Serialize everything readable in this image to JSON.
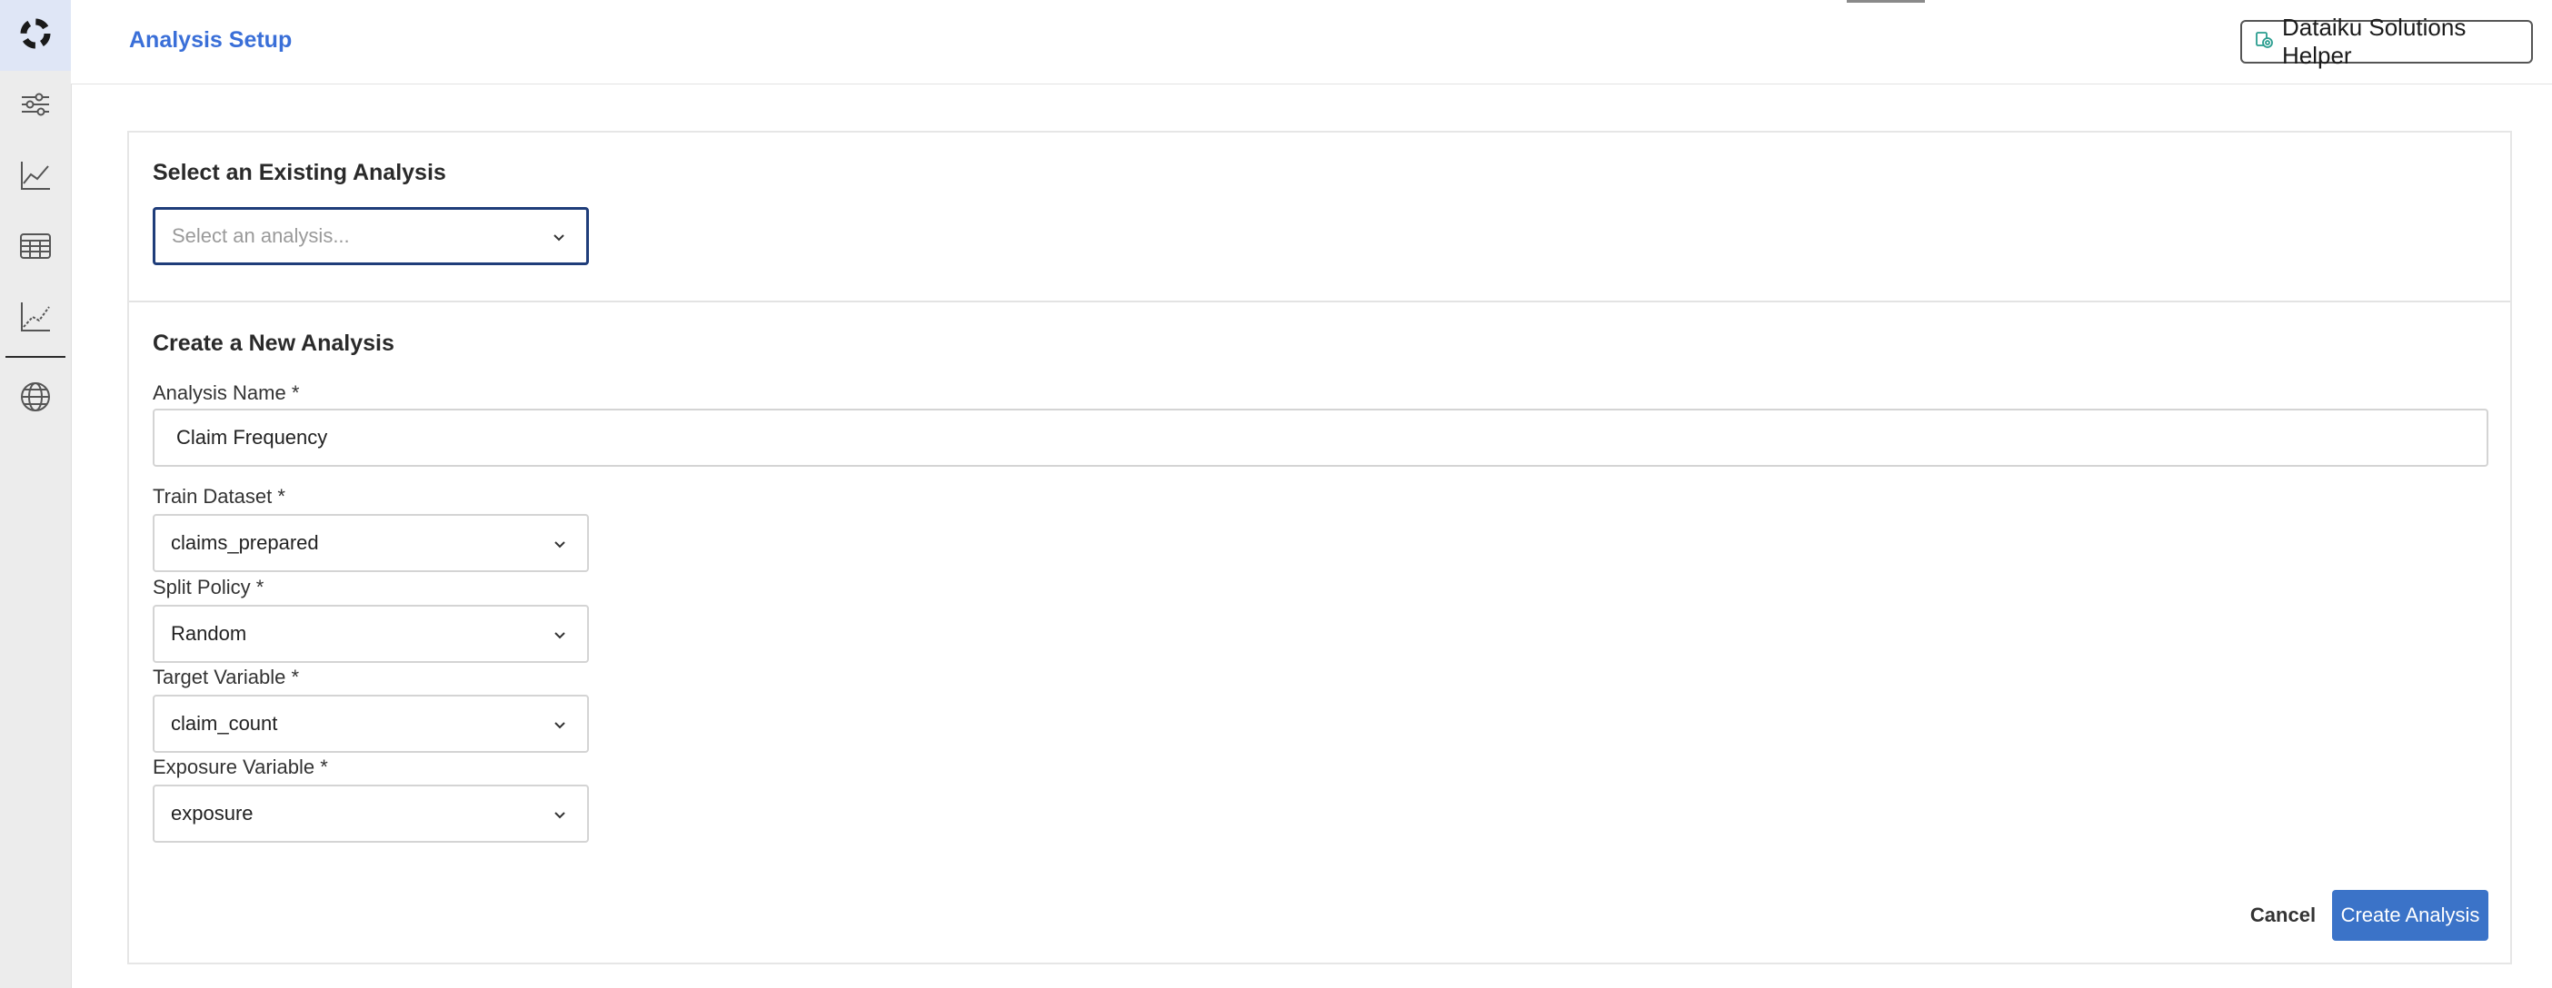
{
  "header": {
    "title": "Analysis Setup",
    "helper_button": "Dataiku Solutions Helper"
  },
  "sidebar": {
    "items": [
      {
        "icon": "app-logo-icon",
        "active": true
      },
      {
        "icon": "sliders-icon"
      },
      {
        "icon": "line-chart-icon"
      },
      {
        "icon": "table-icon"
      },
      {
        "icon": "chart-axes-icon"
      },
      {
        "icon": "globe-icon"
      }
    ]
  },
  "existing": {
    "title": "Select an Existing Analysis",
    "placeholder": "Select an analysis..."
  },
  "create": {
    "title": "Create a New Analysis",
    "fields": {
      "name": {
        "label": "Analysis Name *",
        "value": "Claim Frequency"
      },
      "train": {
        "label": "Train Dataset *",
        "value": "claims_prepared"
      },
      "split": {
        "label": "Split Policy *",
        "value": "Random"
      },
      "target": {
        "label": "Target Variable *",
        "value": "claim_count"
      },
      "exposure": {
        "label": "Exposure Variable *",
        "value": "exposure"
      }
    },
    "cancel_label": "Cancel",
    "submit_label": "Create Analysis"
  },
  "colors": {
    "accent": "#3a6fd8",
    "primary_button": "#3b73c8",
    "focus_border": "#1f3d7a"
  }
}
